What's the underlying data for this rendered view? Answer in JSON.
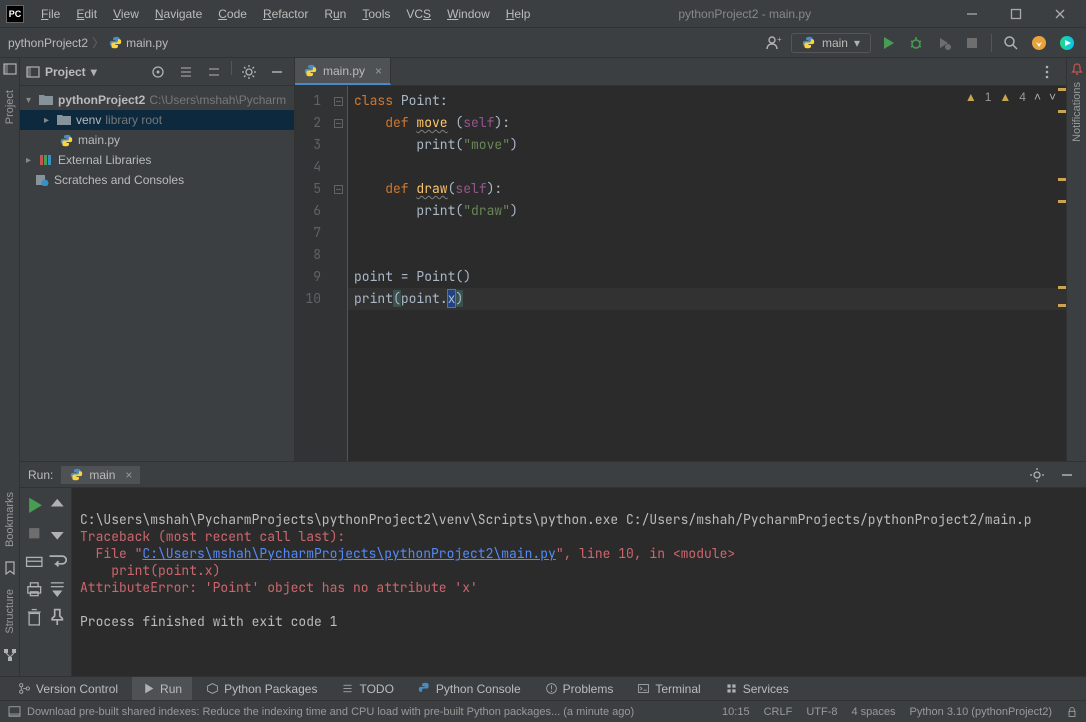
{
  "title": "pythonProject2 - main.py",
  "menubar": [
    "File",
    "Edit",
    "View",
    "Navigate",
    "Code",
    "Refactor",
    "Run",
    "Tools",
    "VCS",
    "Window",
    "Help"
  ],
  "breadcrumb": {
    "project": "pythonProject2",
    "file": "main.py"
  },
  "run_config": {
    "label": "main"
  },
  "project_panel": {
    "title": "Project",
    "tree": {
      "root": {
        "name": "pythonProject2",
        "path": "C:\\Users\\mshah\\Pycharm"
      },
      "venv": {
        "name": "venv",
        "hint": "library root"
      },
      "mainpy": "main.py",
      "ext_lib": "External Libraries",
      "scratches": "Scratches and Consoles"
    }
  },
  "editor": {
    "tab": "main.py",
    "warnings": {
      "w1": "1",
      "w2": "4"
    },
    "lines": [
      "1",
      "2",
      "3",
      "4",
      "5",
      "6",
      "7",
      "8",
      "9",
      "10"
    ],
    "code": {
      "l1a": "class ",
      "l1b": "Point",
      "l1c": ":",
      "l2a": "    def ",
      "l2b": "move",
      "l2c": " (",
      "l2d": "self",
      "l2e": "):",
      "l3a": "        print(",
      "l3b": "\"move\"",
      "l3c": ")",
      "l5a": "    def ",
      "l5b": "draw",
      "l5c": "(",
      "l5d": "self",
      "l5e": "):",
      "l6a": "        print(",
      "l6b": "\"draw\"",
      "l6c": ")",
      "l9a": "point = Point()",
      "l10a": "print",
      "l10b": "(",
      "l10c": "point.",
      "l10d": "x",
      "l10e": ")"
    }
  },
  "run": {
    "label": "Run:",
    "tab": "main",
    "console": {
      "cmd": "C:\\Users\\mshah\\PycharmProjects\\pythonProject2\\venv\\Scripts\\python.exe C:/Users/mshah/PycharmProjects/pythonProject2/main.p",
      "tb": "Traceback (most recent call last):",
      "file_a": "  File \"",
      "file_link": "C:\\Users\\mshah\\PycharmProjects\\pythonProject2\\main.py",
      "file_b": "\", line 10, in <module>",
      "call": "    print(point.x)",
      "err": "AttributeError: 'Point' object has no attribute 'x'",
      "exit": "Process finished with exit code 1"
    }
  },
  "bottom_bar": {
    "version": "Version Control",
    "run": "Run",
    "packages": "Python Packages",
    "todo": "TODO",
    "console": "Python Console",
    "problems": "Problems",
    "terminal": "Terminal",
    "services": "Services"
  },
  "status": {
    "msg": "Download pre-built shared indexes: Reduce the indexing time and CPU load with pre-built Python packages... (a minute ago)",
    "pos": "10:15",
    "eol": "CRLF",
    "enc": "UTF-8",
    "indent": "4 spaces",
    "interp": "Python 3.10 (pythonProject2)"
  },
  "side_labels": {
    "project": "Project",
    "bookmarks": "Bookmarks",
    "structure": "Structure",
    "notifications": "Notifications"
  }
}
